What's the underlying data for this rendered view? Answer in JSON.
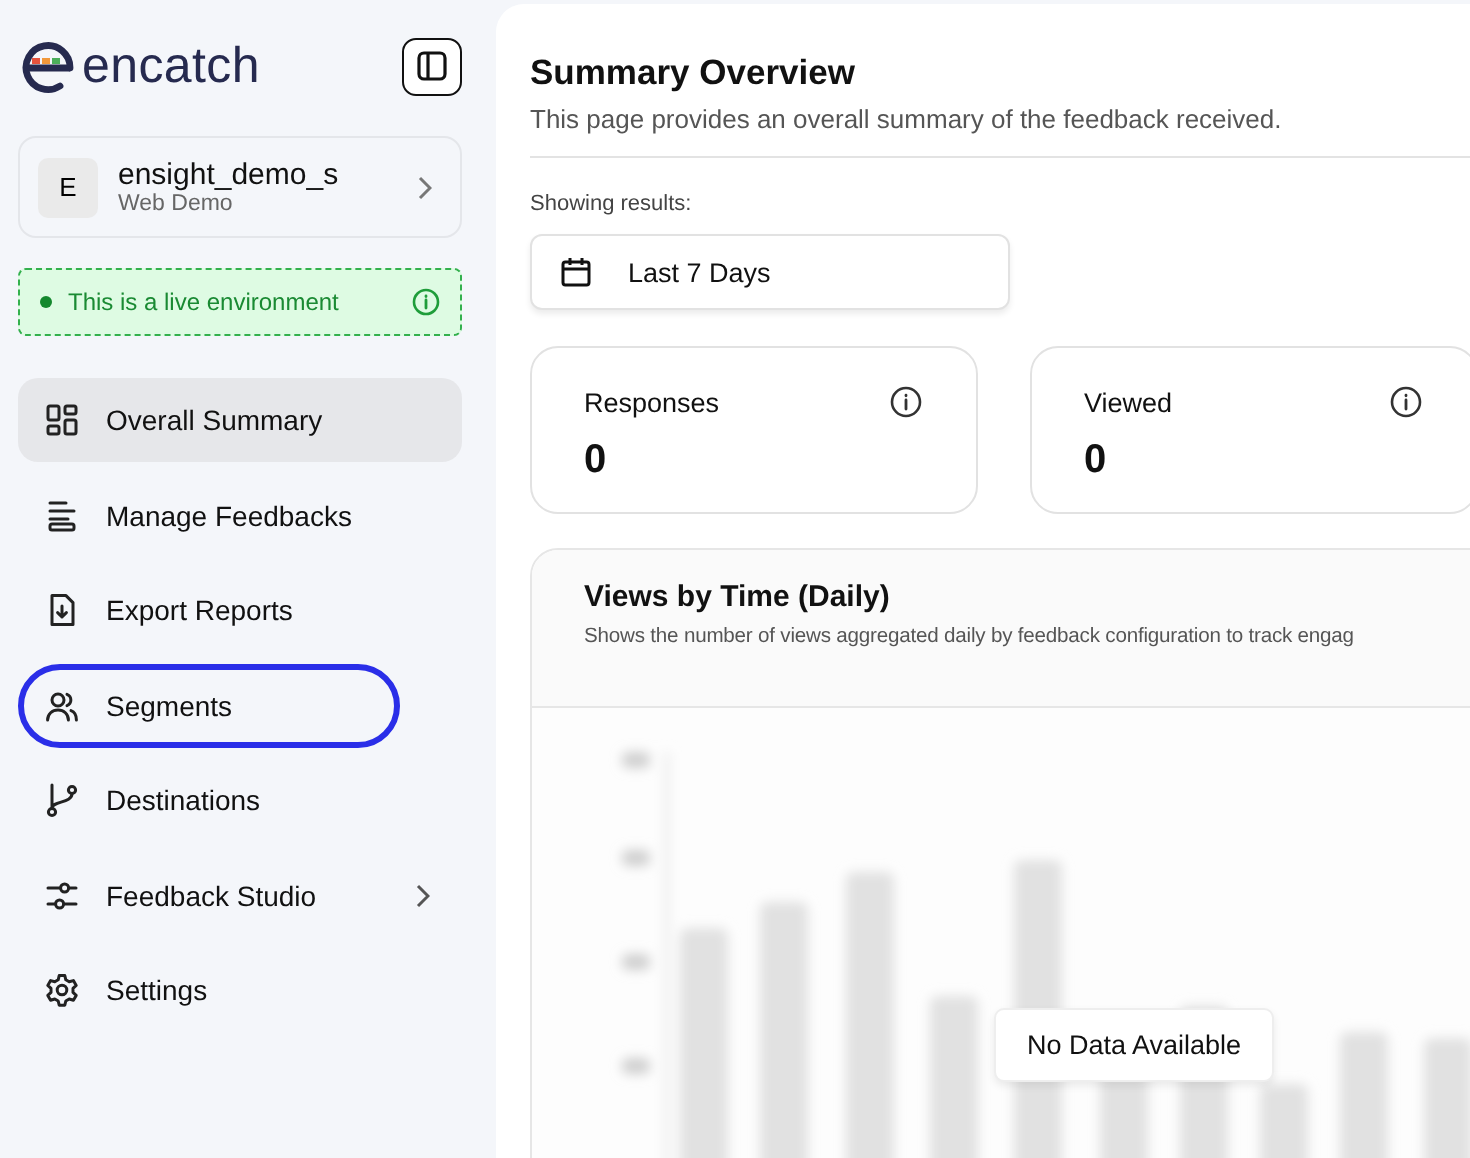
{
  "brand": {
    "name": "encatch"
  },
  "workspace": {
    "initial": "E",
    "name": "ensight_demo_s",
    "subtitle": "Web Demo"
  },
  "environment_banner": {
    "text": "This is a live environment"
  },
  "nav": [
    {
      "label": "Overall Summary",
      "selected": true,
      "highlighted": false,
      "has_submenu": false
    },
    {
      "label": "Manage Feedbacks",
      "selected": false,
      "highlighted": false,
      "has_submenu": false
    },
    {
      "label": "Export Reports",
      "selected": false,
      "highlighted": false,
      "has_submenu": false
    },
    {
      "label": "Segments",
      "selected": false,
      "highlighted": true,
      "has_submenu": false
    },
    {
      "label": "Destinations",
      "selected": false,
      "highlighted": false,
      "has_submenu": false
    },
    {
      "label": "Feedback Studio",
      "selected": false,
      "highlighted": false,
      "has_submenu": true
    },
    {
      "label": "Settings",
      "selected": false,
      "highlighted": false,
      "has_submenu": false
    }
  ],
  "page": {
    "title": "Summary Overview",
    "subtitle": "This page provides an overall summary of the feedback received."
  },
  "filter": {
    "label": "Showing results:",
    "range": "Last 7 Days"
  },
  "stats": [
    {
      "label": "Responses",
      "value": "0"
    },
    {
      "label": "Viewed",
      "value": "0"
    }
  ],
  "chart_card": {
    "title": "Views by Time (Daily)",
    "description": "Shows the number of views aggregated daily by feedback configuration to track engag",
    "empty_message": "No Data Available"
  }
}
